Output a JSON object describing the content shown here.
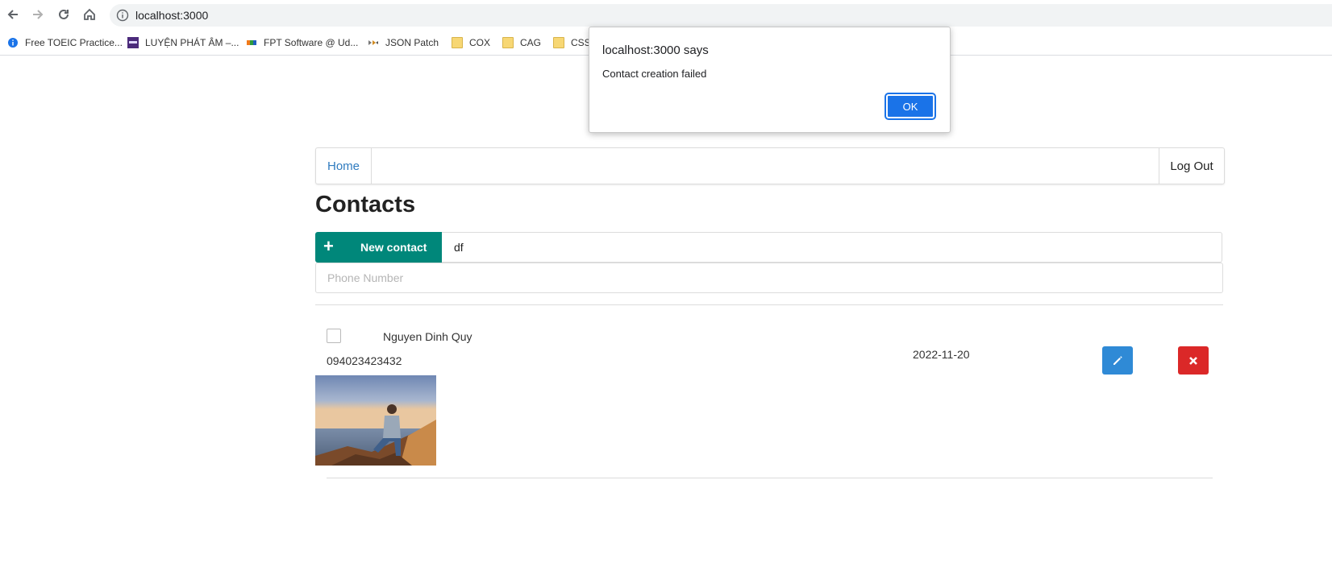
{
  "browser": {
    "url": "localhost:3000",
    "bookmarks": [
      {
        "label": "Free TOEIC Practice...",
        "icon": "info-circle-icon"
      },
      {
        "label": "LUYỆN PHÁT ÂM –...",
        "icon": "site-favicon"
      },
      {
        "label": "FPT Software @ Ud...",
        "icon": "fpt-favicon"
      },
      {
        "label": "JSON Patch",
        "icon": "json-patch-favicon"
      },
      {
        "label": "COX",
        "icon": "folder-icon"
      },
      {
        "label": "CAG",
        "icon": "folder-icon"
      },
      {
        "label": "CSS",
        "icon": "folder-icon"
      }
    ]
  },
  "dialog": {
    "title": "localhost:3000 says",
    "message": "Contact creation failed",
    "ok_label": "OK"
  },
  "nav": {
    "home_label": "Home",
    "logout_label": "Log Out"
  },
  "page": {
    "title": "Contacts"
  },
  "form": {
    "new_contact_label": "New contact",
    "name_value": "df",
    "phone_placeholder": "Phone Number"
  },
  "contacts": [
    {
      "name": "Nguyen Dinh Quy",
      "phone": "094023423432",
      "date": "2022-11-20",
      "checked": false
    }
  ],
  "colors": {
    "new_contact_button": "#00877a",
    "edit_button": "#2f8ad6",
    "delete_button": "#db2828",
    "dialog_ok": "#1a73e8",
    "home_link": "#2f7bbf"
  }
}
